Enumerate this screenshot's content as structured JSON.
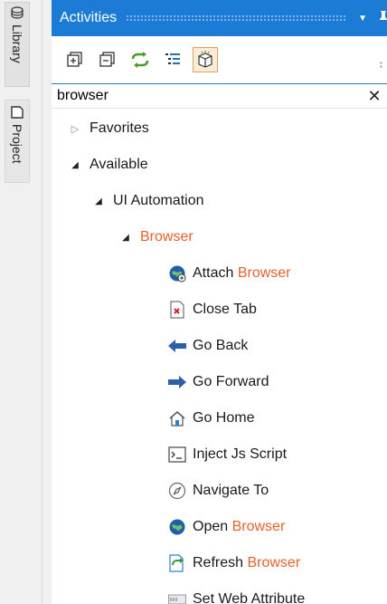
{
  "sidebar": {
    "tabs": [
      {
        "label": "Library",
        "icon": "library-icon"
      },
      {
        "label": "Project",
        "icon": "project-icon"
      }
    ]
  },
  "panel": {
    "title": "Activities",
    "header_icons": [
      "dropdown-arrow-icon",
      "pin-icon"
    ],
    "toolbar": [
      {
        "name": "expand-all-button",
        "icon": "expand-all-icon"
      },
      {
        "name": "collapse-all-button",
        "icon": "collapse-all-icon"
      },
      {
        "name": "refresh-button",
        "icon": "refresh-icon"
      },
      {
        "name": "list-view-button",
        "icon": "list-icon"
      },
      {
        "name": "filter-button",
        "icon": "filter-box-icon",
        "active": true
      }
    ],
    "search": {
      "value": "browser",
      "clear_label": "✕"
    },
    "highlight_color": "#e8602c",
    "tree": {
      "favorites": "Favorites",
      "available": "Available",
      "ui_automation": "UI Automation",
      "browser": "Browser",
      "activities": [
        {
          "icon": "globe-link-icon",
          "before": "Attach ",
          "match": "Browser"
        },
        {
          "icon": "close-tab-icon",
          "before": "Close Tab",
          "match": ""
        },
        {
          "icon": "arrow-left-icon",
          "before": "Go Back",
          "match": ""
        },
        {
          "icon": "arrow-right-icon",
          "before": "Go Forward",
          "match": ""
        },
        {
          "icon": "home-icon",
          "before": "Go Home",
          "match": ""
        },
        {
          "icon": "terminal-icon",
          "before": "Inject Js Script",
          "match": ""
        },
        {
          "icon": "compass-icon",
          "before": "Navigate To",
          "match": ""
        },
        {
          "icon": "globe-icon",
          "before": "Open ",
          "match": "Browser"
        },
        {
          "icon": "refresh-page-icon",
          "before": "Refresh ",
          "match": "Browser"
        },
        {
          "icon": "web-attribute-icon",
          "before": "Set Web Attribute",
          "match": ""
        }
      ]
    }
  }
}
